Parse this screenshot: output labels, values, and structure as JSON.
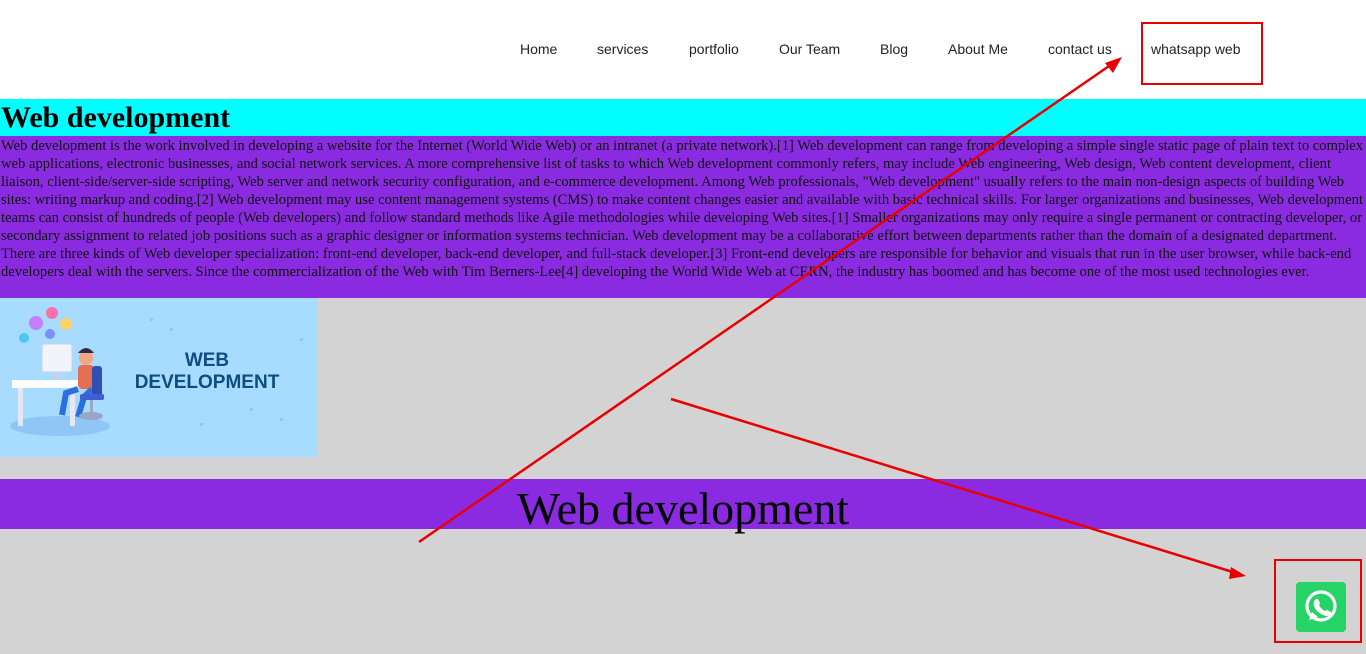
{
  "nav": {
    "items": [
      {
        "label": "Home"
      },
      {
        "label": "services"
      },
      {
        "label": "portfolio"
      },
      {
        "label": "Our Team"
      },
      {
        "label": "Blog"
      },
      {
        "label": "About Me"
      },
      {
        "label": "contact us"
      },
      {
        "label": "whatsapp web"
      }
    ]
  },
  "hero": {
    "title": "Web development"
  },
  "content": {
    "paragraph": "Web development is the work involved in developing a website for the Internet (World Wide Web) or an intranet (a private network).[1] Web development can range from developing a simple single static page of plain text to complex web applications, electronic businesses, and social network services. A more comprehensive list of tasks to which Web development commonly refers, may include Web engineering, Web design, Web content development, client liaison, client-side/server-side scripting, Web server and network security configuration, and e-commerce development. Among Web professionals, \"Web development\" usually refers to the main non-design aspects of building Web sites: writing markup and coding.[2] Web development may use content management systems (CMS) to make content changes easier and available with basic technical skills. For larger organizations and businesses, Web development teams can consist of hundreds of people (Web developers) and follow standard methods like Agile methodologies while developing Web sites.[1] Smaller organizations may only require a single permanent or contracting developer, or secondary assignment to related job positions such as a graphic designer or information systems technician. Web development may be a collaborative effort between departments rather than the domain of a designated department. There are three kinds of Web developer specialization: front-end developer, back-end developer, and full-stack developer.[3] Front-end developers are responsible for behavior and visuals that run in the user browser, while back-end developers deal with the servers. Since the commercialization of the Web with Tim Berners-Lee[4] developing the World Wide Web at CERN, the industry has boomed and has become one of the most used technologies ever."
  },
  "banner": {
    "line1": "WEB",
    "line2": "DEVELOPMENT"
  },
  "section": {
    "heading": "Web development"
  },
  "whatsapp": {
    "icon": "whatsapp-icon"
  },
  "colors": {
    "hero_bg": "#00ffff",
    "purple": "#8a2be2",
    "page_bg": "#d3d3d3",
    "annotation": "#e80000",
    "whatsapp_green": "#25d366"
  }
}
